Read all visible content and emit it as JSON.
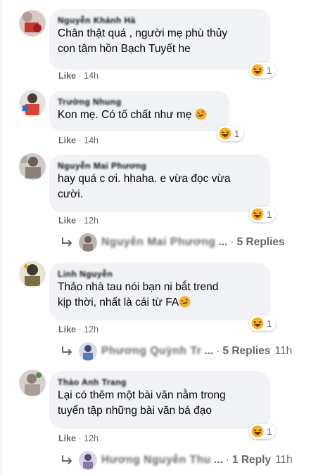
{
  "comments": [
    {
      "author": "Nguyễn Khánh Hà",
      "text_lines": [
        "Chân thật quá , người mẹ phù thủy",
        "con tâm hồn Bạch Tuyết he"
      ],
      "reaction_count": "1",
      "like": "Like",
      "sep": "·",
      "time": "14h"
    },
    {
      "author": "Trường Nhung",
      "text_lines": [
        "Kon mẹ. Có tố chất như mẹ"
      ],
      "reaction_count": "1",
      "like": "Like",
      "sep": "·",
      "time": "14h"
    },
    {
      "author": "Nguyễn Mai Phương",
      "text_lines": [
        "hay quá c ơi. hhaha. e vừa đọc vừa",
        "cười."
      ],
      "reaction_count": "1",
      "like": "Like",
      "sep": "·",
      "time": "12h",
      "reply": {
        "name": "Nguyễn Mai Phương",
        "ellipsis": "...",
        "dot": "·",
        "label": "5 Replies",
        "time": ""
      }
    },
    {
      "author": "Linh Nguyễn",
      "text_lines": [
        "Thảo nhà tau nói bạn ni bắt trend",
        "kịp thời, nhất là cái từ FA"
      ],
      "reaction_count": "1",
      "like": "Like",
      "sep": "·",
      "time": "12h",
      "reply": {
        "name": "Phương Quỳnh Tr",
        "ellipsis": "...",
        "dot": "·",
        "label": "5 Replies",
        "time": "11h"
      }
    },
    {
      "author": "Thảo Anh Trang",
      "text_lines": [
        "Lại có thêm một bài văn nằm trong",
        "tuyển tập những bài văn bá đạo"
      ],
      "reaction_count": "1",
      "like": "Like",
      "sep": "·",
      "time": "12h",
      "reply": {
        "name": "Hương Nguyễn Thu",
        "ellipsis": "...",
        "dot": "·",
        "label": "1 Reply",
        "time": "11h"
      }
    }
  ],
  "colors": {
    "bubble": "#f0f2f5",
    "meta": "#65676b",
    "text": "#050505"
  },
  "icons": {
    "reaction": "haha-emoji-icon",
    "reply": "reply-arrow-icon"
  }
}
